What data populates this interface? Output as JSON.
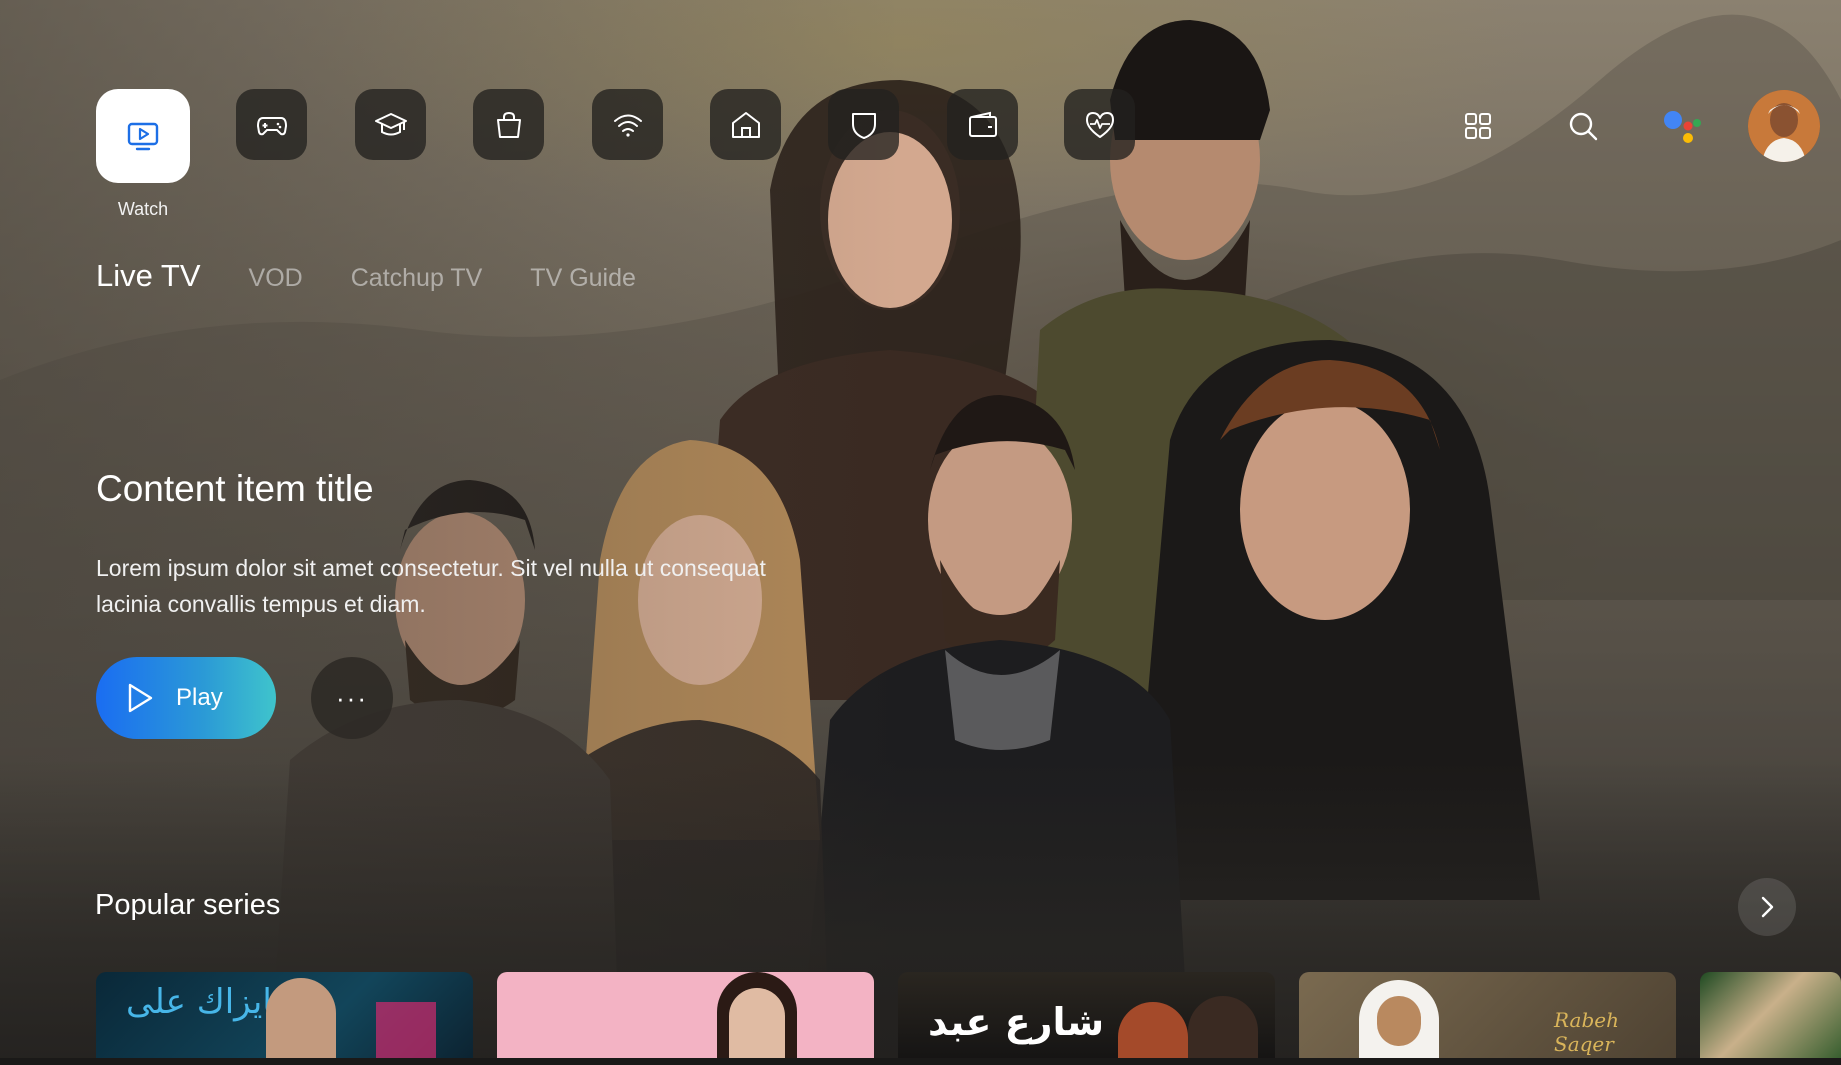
{
  "nav": {
    "active_label": "Watch",
    "icons": [
      "watch-icon",
      "gamepad-icon",
      "graduation-cap-icon",
      "shopping-bag-icon",
      "wifi-icon",
      "home-icon",
      "shield-icon",
      "wallet-icon",
      "heart-pulse-icon"
    ],
    "right_icons": [
      "grid-icon",
      "search-icon",
      "assistant-icon",
      "avatar"
    ]
  },
  "tabs": [
    "Live TV",
    "VOD",
    "Catchup TV",
    "TV Guide"
  ],
  "hero": {
    "title": "Content item title",
    "description": "Lorem ipsum dolor sit amet consectetur. Sit vel nulla ut consequat lacinia convallis tempus et diam.",
    "play_label": "Play",
    "more_label": "···"
  },
  "popular": {
    "title": "Popular series",
    "cards": [
      {
        "title_ar": "عايزاك على",
        "bg": "#0f2d3f"
      },
      {
        "title_ar": "",
        "bg": "#f3b3c4"
      },
      {
        "title_ar": "شارع عبد",
        "bg": "#1d1d1f"
      },
      {
        "title_ar": "Rabeh Saqer",
        "bg": "#6b5b43"
      },
      {
        "title_ar": "",
        "bg": "#2f4a2a"
      }
    ]
  },
  "colors": {
    "accent_start": "#1a6df2",
    "accent_end": "#3fc4cc"
  }
}
